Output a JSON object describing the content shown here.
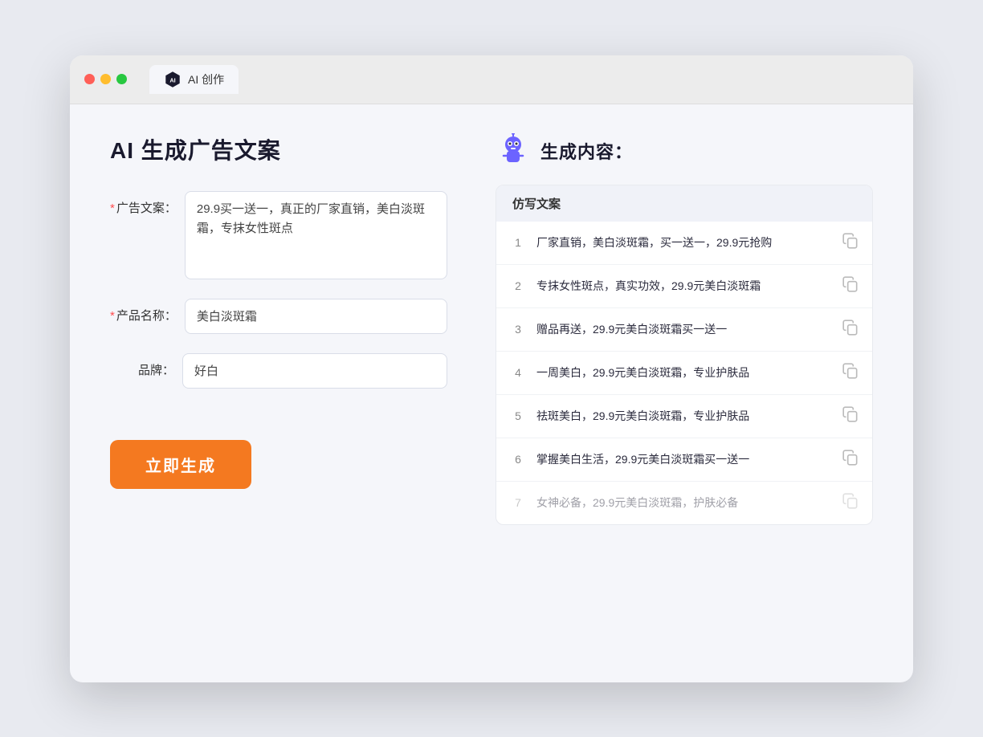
{
  "window": {
    "tab_label": "AI 创作"
  },
  "left_panel": {
    "title": "AI 生成广告文案",
    "fields": [
      {
        "label": "广告文案：",
        "required": true,
        "type": "textarea",
        "value": "29.9买一送一，真正的厂家直销，美白淡斑霜，专抹女性斑点",
        "name": "ad-copy-field"
      },
      {
        "label": "产品名称：",
        "required": true,
        "type": "input",
        "value": "美白淡斑霜",
        "name": "product-name-field"
      },
      {
        "label": "品牌：",
        "required": false,
        "type": "input",
        "value": "好白",
        "name": "brand-field"
      }
    ],
    "generate_btn": "立即生成"
  },
  "right_panel": {
    "title": "生成内容：",
    "table_header": "仿写文案",
    "results": [
      {
        "num": 1,
        "text": "厂家直销，美白淡斑霜，买一送一，29.9元抢购"
      },
      {
        "num": 2,
        "text": "专抹女性斑点，真实功效，29.9元美白淡斑霜"
      },
      {
        "num": 3,
        "text": "赠品再送，29.9元美白淡斑霜买一送一"
      },
      {
        "num": 4,
        "text": "一周美白，29.9元美白淡斑霜，专业护肤品"
      },
      {
        "num": 5,
        "text": "祛斑美白，29.9元美白淡斑霜，专业护肤品"
      },
      {
        "num": 6,
        "text": "掌握美白生活，29.9元美白淡斑霜买一送一"
      },
      {
        "num": 7,
        "text": "女神必备，29.9元美白淡斑霜，护肤必备",
        "faded": true
      }
    ]
  },
  "colors": {
    "orange": "#f47920",
    "red_light": "#ff4d4f",
    "bg": "#f5f6fa"
  }
}
